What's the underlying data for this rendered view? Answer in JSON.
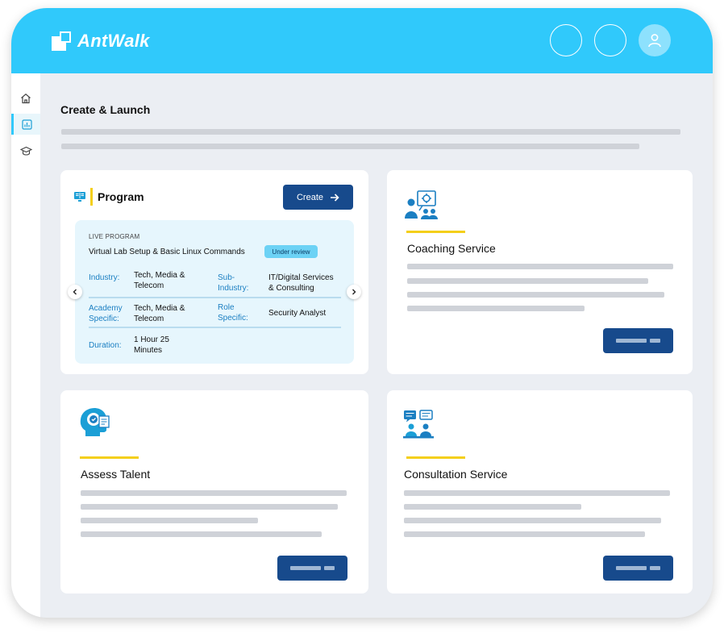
{
  "app": {
    "brand": "AntWalk",
    "brand_color": "#30c9fb",
    "accent_color": "#f4cf1b",
    "button_color": "#174a8c"
  },
  "topbar": {
    "icons": [
      "circle-button",
      "circle-button",
      "user-icon"
    ]
  },
  "sidebar": {
    "items": [
      {
        "icon": "home-icon",
        "active": false
      },
      {
        "icon": "chart-icon",
        "active": true
      },
      {
        "icon": "graduation-cap-icon",
        "active": false
      }
    ]
  },
  "page": {
    "title": "Create & Launch"
  },
  "program": {
    "title": "Program",
    "create_label": "Create",
    "live_label": "LIVE PROGRAM",
    "name": "Virtual Lab Setup & Basic Linux Commands",
    "status": "Under review",
    "fields": {
      "industry_key": "Industry:",
      "industry_val": "Tech, Media & Telecom",
      "subindustry_key": "Sub-Industry:",
      "subindustry_val": "IT/Digital Services & Consulting",
      "academy_key": "Academy Specific:",
      "academy_val": "Tech, Media & Telecom",
      "role_key": "Role Specific:",
      "role_val": "Security Analyst",
      "duration_key": "Duration:",
      "duration_val": "1 Hour 25 Minutes"
    }
  },
  "services": {
    "coaching": {
      "title": "Coaching Service",
      "icon": "coaching-icon"
    },
    "assess": {
      "title": "Assess Talent",
      "icon": "assess-talent-icon"
    },
    "consultation": {
      "title": "Consultation Service",
      "icon": "consultation-icon"
    }
  }
}
